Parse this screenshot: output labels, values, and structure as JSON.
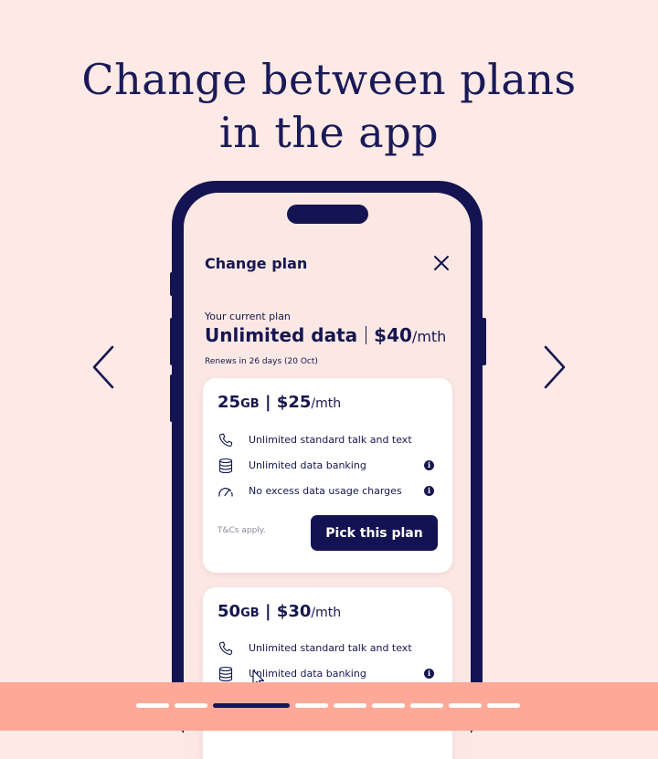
{
  "headline": {
    "line1": "Change between plans",
    "line2": "in the app"
  },
  "nav": {
    "prev_icon": "chevron-left-icon",
    "next_icon": "chevron-right-icon"
  },
  "sheet": {
    "title": "Change plan",
    "close_icon": "close-icon",
    "current_label": "Your current plan",
    "current_name": "Unlimited data",
    "current_price": "$40",
    "current_period": "/mth",
    "renews": "Renews in 26 days (20 Oct)"
  },
  "plans": [
    {
      "amount": "25",
      "unit": "GB",
      "separator": "|",
      "price": "$25",
      "period": "/mth",
      "features": [
        {
          "icon": "phone-icon",
          "text": "Unlimited standard talk and text",
          "info": false
        },
        {
          "icon": "database-icon",
          "text": "Unlimited data banking",
          "info": true
        },
        {
          "icon": "speedometer-icon",
          "text": "No excess data usage charges",
          "info": true
        }
      ],
      "tcs": "T&Cs apply.",
      "button": "Pick this plan"
    },
    {
      "amount": "50",
      "unit": "GB",
      "separator": "|",
      "price": "$30",
      "period": "/mth",
      "features": [
        {
          "icon": "phone-icon",
          "text": "Unlimited standard talk and text",
          "info": false
        },
        {
          "icon": "database-icon",
          "text": "Unlimited data banking",
          "info": true
        }
      ]
    }
  ],
  "info_glyph": "i",
  "carousel": {
    "slide_count": 10,
    "active_index": 2
  },
  "colors": {
    "background": "#fde9e5",
    "navy": "#161650",
    "bottom_bar": "#fea898",
    "card": "#ffffff"
  }
}
